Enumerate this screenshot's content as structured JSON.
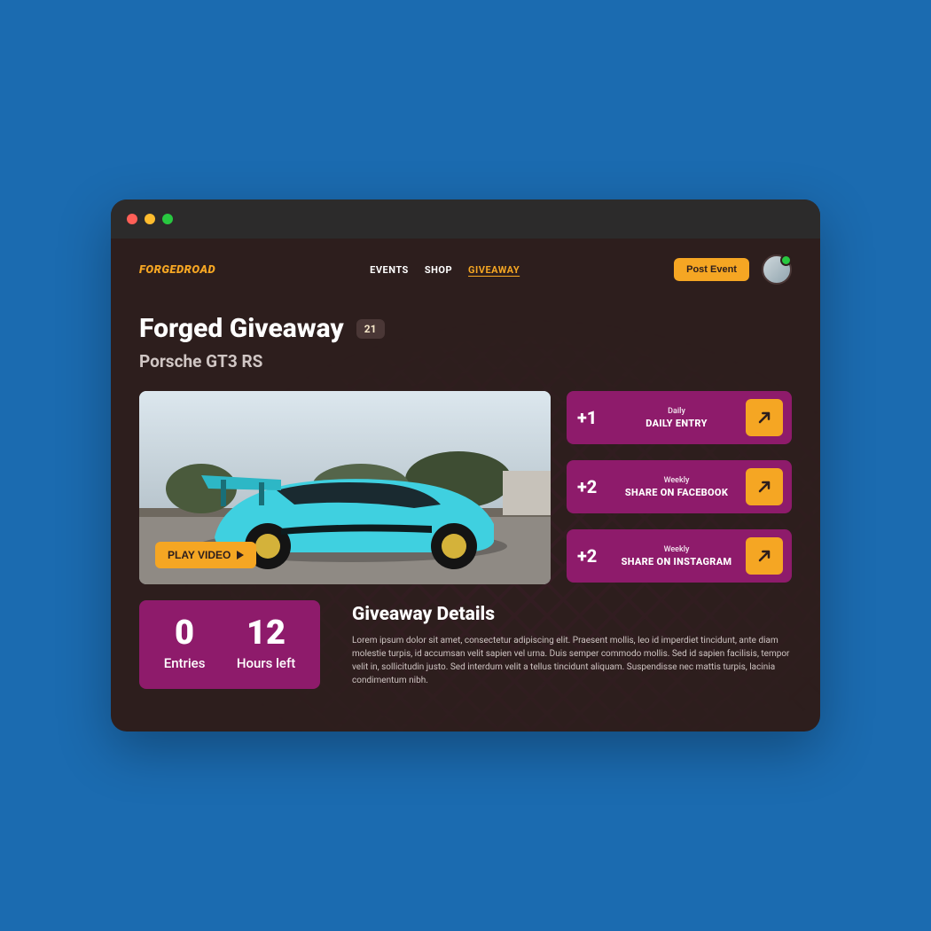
{
  "brand": "FORGEDROAD",
  "nav": {
    "events": "EVENTS",
    "shop": "SHOP",
    "giveaway": "GIVEAWAY"
  },
  "post_event_label": "Post Event",
  "page_title": "Forged Giveaway",
  "badge_count": "21",
  "subtitle": "Porsche GT3 RS",
  "play_video_label": "PLAY VIDEO",
  "actions": [
    {
      "points": "+1",
      "frequency": "Daily",
      "label": "DAILY ENTRY"
    },
    {
      "points": "+2",
      "frequency": "Weekly",
      "label": "SHARE ON FACEBOOK"
    },
    {
      "points": "+2",
      "frequency": "Weekly",
      "label": "SHARE ON INSTAGRAM"
    }
  ],
  "stats": {
    "entries_value": "0",
    "entries_label": "Entries",
    "hours_value": "12",
    "hours_label": "Hours left"
  },
  "details": {
    "title": "Giveaway Details",
    "body": "Lorem ipsum dolor sit amet, consectetur adipiscing elit. Praesent mollis, leo id imperdiet tincidunt, ante diam molestie turpis, id accumsan velit sapien vel urna. Duis semper commodo mollis. Sed id sapien facilisis, tempor velit in, sollicitudin justo. Sed interdum velit a tellus tincidunt aliquam. Suspendisse nec mattis turpis, lacinia condimentum nibh."
  },
  "colors": {
    "accent": "#f5a623",
    "magenta": "#8e1b6b"
  }
}
